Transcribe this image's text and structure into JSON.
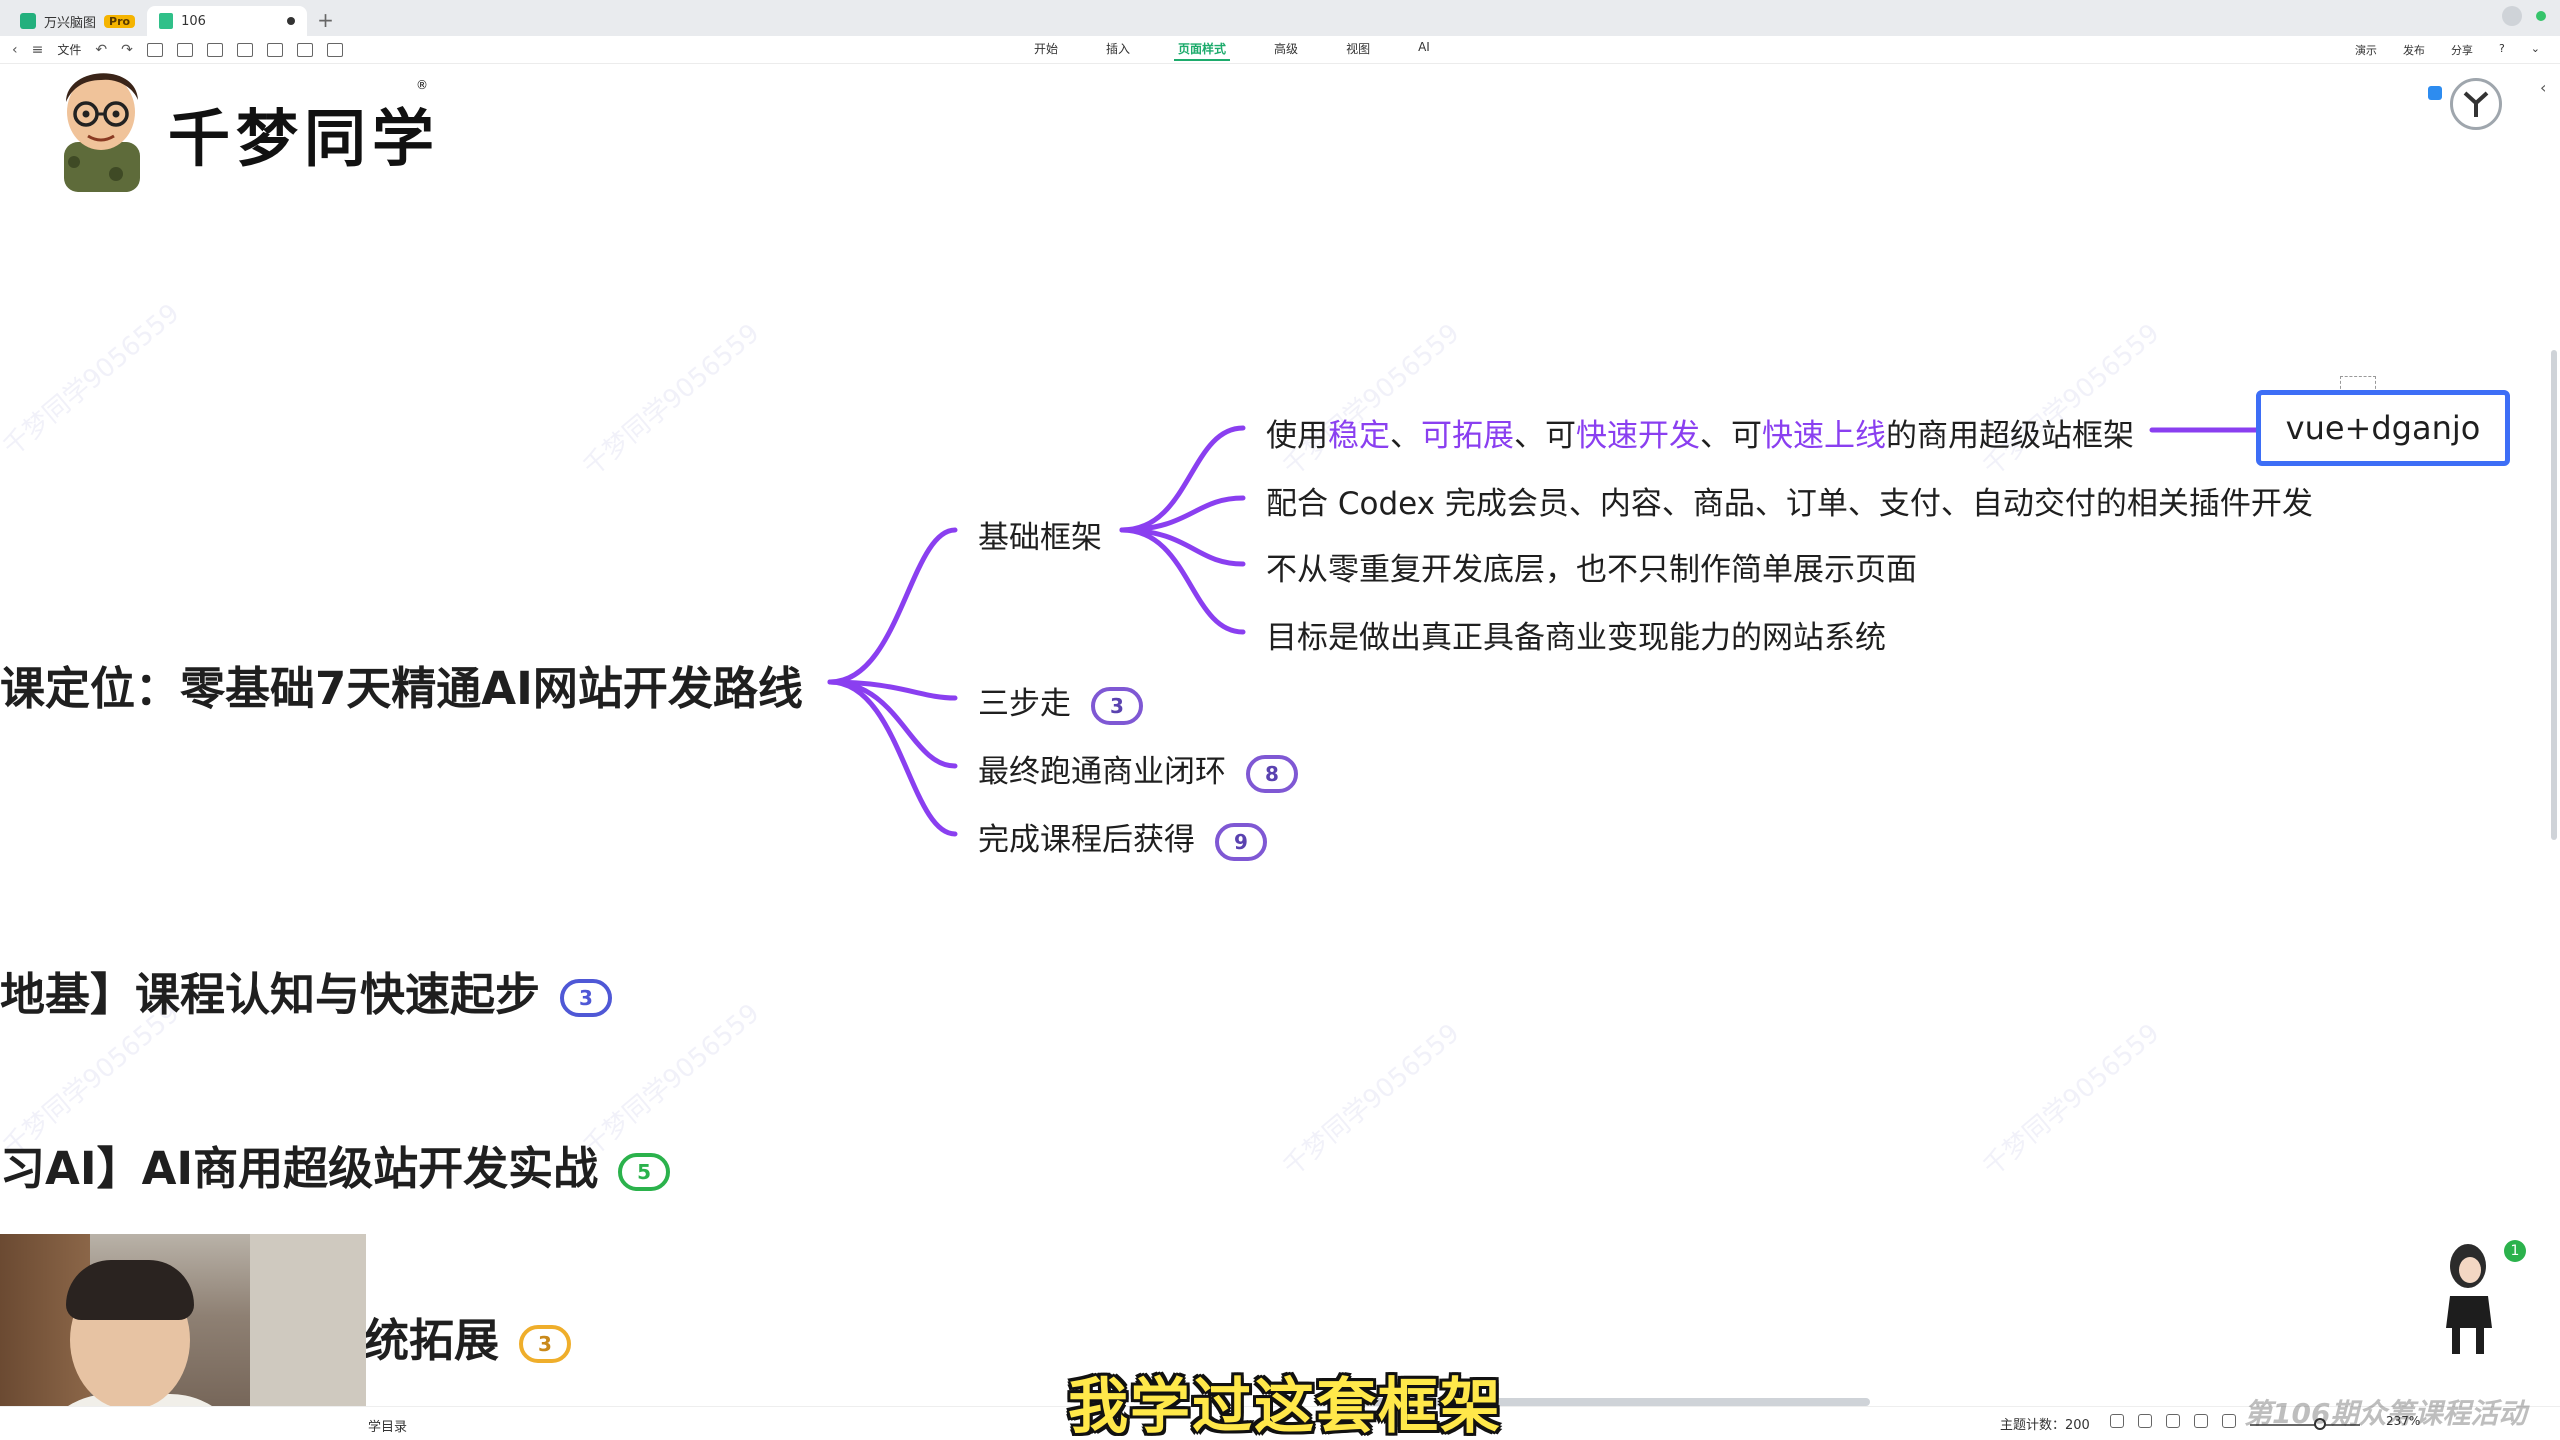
{
  "titlebar": {
    "app_tab_label": "万兴脑图",
    "pro_badge": "Pro",
    "doc_tab_label": "106",
    "new_tab": "+"
  },
  "toolbar": {
    "file_label": "文件",
    "menus": [
      "开始",
      "插入",
      "页面样式",
      "高级",
      "视图",
      "AI"
    ],
    "active_menu_index": 2,
    "right": [
      "演示",
      "发布",
      "分享"
    ]
  },
  "brand": {
    "name": "千梦同学",
    "registered": "®"
  },
  "watermark_text": "千梦同学9056559",
  "mindmap": {
    "root": "课定位：零基础7天精通AI网站开发路线",
    "branches": [
      {
        "label": "基础框架"
      },
      {
        "label": "三步走",
        "count": "3"
      },
      {
        "label": "最终跑通商业闭环",
        "count": "8"
      },
      {
        "label": "完成课程后获得",
        "count": "9"
      }
    ],
    "leaf1": {
      "p1": "使用",
      "h1": "稳定",
      "p2": "、",
      "h2": "可拓展",
      "p3": "、可",
      "h3": "快速开发",
      "p4": "、可",
      "h4": "快速上线",
      "p5": "的商用超级站框架"
    },
    "leaf2": "配合 Codex 完成会员、内容、商品、订单、支付、自动交付的相关插件开发",
    "leaf3": "不从零重复开发底层，也不只制作简单展示页面",
    "leaf4": "目标是做出真正具备商业变现能力的网站系统",
    "vue_box": "vue+dganjo",
    "chapters": [
      {
        "label": "地基】课程认知与快速起步",
        "count": "3"
      },
      {
        "label": "习AI】AI商用超级站开发实战",
        "count": "5"
      },
      {
        "label": "统拓展",
        "count": "3"
      }
    ]
  },
  "colors": {
    "branch_line": "#8a3ff0",
    "highlight": "#8a3ff0",
    "selection": "#3d6ef6",
    "badge_blue": "#4f58d6",
    "badge_green": "#2bb24c",
    "badge_orange": "#efae2b",
    "subtitle": "#ffe84a"
  },
  "statusbar": {
    "outline": "学目录",
    "topic_count": "主题计数：200",
    "zoom": "237%"
  },
  "notification_count": "1",
  "subtitle": "我学过这套框架",
  "bottom_watermark": "第106期众筹课程活动"
}
